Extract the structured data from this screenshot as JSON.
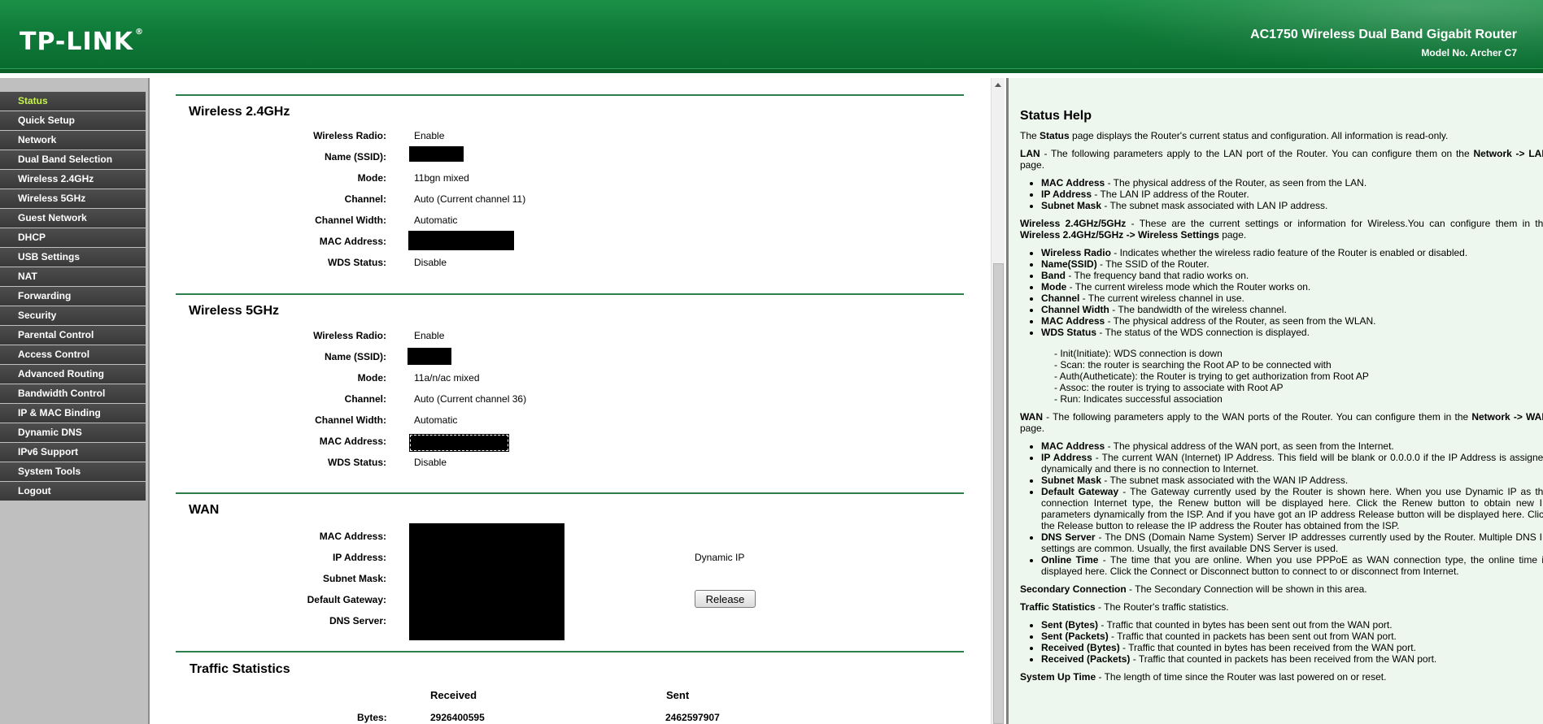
{
  "header": {
    "logo": "TP-LINK",
    "logo_mark": "®",
    "router_title": "AC1750 Wireless Dual Band Gigabit Router",
    "model_no": "Model No. Archer C7"
  },
  "nav": {
    "items": [
      {
        "label": "Status",
        "active": true
      },
      {
        "label": "Quick Setup"
      },
      {
        "label": "Network"
      },
      {
        "label": "Dual Band Selection"
      },
      {
        "label": "Wireless 2.4GHz"
      },
      {
        "label": "Wireless 5GHz"
      },
      {
        "label": "Guest Network"
      },
      {
        "label": "DHCP"
      },
      {
        "label": "USB Settings"
      },
      {
        "label": "NAT"
      },
      {
        "label": "Forwarding"
      },
      {
        "label": "Security"
      },
      {
        "label": "Parental Control"
      },
      {
        "label": "Access Control"
      },
      {
        "label": "Advanced Routing"
      },
      {
        "label": "Bandwidth Control"
      },
      {
        "label": "IP & MAC Binding"
      },
      {
        "label": "Dynamic DNS"
      },
      {
        "label": "IPv6 Support"
      },
      {
        "label": "System Tools"
      },
      {
        "label": "Logout"
      }
    ]
  },
  "w24": {
    "title": "Wireless 2.4GHz",
    "labels": [
      "Wireless Radio:",
      "Name (SSID):",
      "Mode:",
      "Channel:",
      "Channel Width:",
      "MAC Address:",
      "WDS Status:"
    ],
    "radio": "Enable",
    "mode": "11bgn mixed",
    "channel": "Auto (Current channel 11)",
    "width": "Automatic",
    "wds": "Disable"
  },
  "w5": {
    "title": "Wireless 5GHz",
    "labels": [
      "Wireless Radio:",
      "Name (SSID):",
      "Mode:",
      "Channel:",
      "Channel Width:",
      "MAC Address:",
      "WDS Status:"
    ],
    "radio": "Enable",
    "mode": "11a/n/ac mixed",
    "channel": "Auto (Current channel 36)",
    "width": "Automatic",
    "wds": "Disable"
  },
  "wan": {
    "title": "WAN",
    "labels": [
      "MAC Address:",
      "IP Address:",
      "Subnet Mask:",
      "Default Gateway:",
      "DNS Server:"
    ],
    "connection_type": "Dynamic IP",
    "release_label": "Release"
  },
  "traffic": {
    "title": "Traffic Statistics",
    "received_header": "Received",
    "sent_header": "Sent",
    "bytes_label": "Bytes:",
    "bytes_received": "2926400595",
    "bytes_sent": "2462597907"
  },
  "help": {
    "title": "Status Help",
    "intro_pre": "The ",
    "intro_b": "Status",
    "intro_post": " page displays the Router's current status and configuration. All information is read-only.",
    "lan_b": "LAN",
    "lan_text": " - The following parameters apply to the LAN port of the Router. You can configure them on the ",
    "lan_link": "Network -> LAN",
    "lan_end": " page.",
    "lan_items": [
      {
        "b": "MAC Address",
        "t": " - The physical address of the Router, as seen from the LAN."
      },
      {
        "b": "IP Address",
        "t": " - The LAN IP address of the Router."
      },
      {
        "b": "Subnet Mask",
        "t": " - The subnet mask associated with LAN IP address."
      }
    ],
    "wl_b": "Wireless 2.4GHz/5GHz",
    "wl_text": " - These are the current settings or information for Wireless.You can configure them in the ",
    "wl_link": "Wireless 2.4GHz/5GHz -> Wireless Settings",
    "wl_end": " page.",
    "wl_items": [
      {
        "b": "Wireless Radio",
        "t": " - Indicates whether the wireless radio feature of the Router is enabled or disabled."
      },
      {
        "b": "Name(SSID)",
        "t": " - The SSID of the Router."
      },
      {
        "b": "Band",
        "t": " - The frequency band that radio works on."
      },
      {
        "b": "Mode",
        "t": " - The current wireless mode which the Router works on."
      },
      {
        "b": "Channel",
        "t": " - The current wireless channel in use."
      },
      {
        "b": "Channel Width",
        "t": " - The bandwidth of the wireless channel."
      },
      {
        "b": "MAC Address",
        "t": " - The physical address of the Router, as seen from the WLAN."
      },
      {
        "b": "WDS Status",
        "t": " - The status of the WDS connection is displayed."
      }
    ],
    "wds_states": [
      "- Init(Initiate): WDS connection is down",
      "- Scan: the router is searching the Root AP to be connected with",
      "- Auth(Autheticate): the Router is trying to get authorization from Root AP",
      "- Assoc: the router is trying to associate with Root AP",
      "- Run: Indicates successful association"
    ],
    "wan_b": "WAN",
    "wan_text": " - The following parameters apply to the WAN ports of the Router. You can configure them in the ",
    "wan_link": "Network -> WAN",
    "wan_end": " page.",
    "wan_items": [
      {
        "b": "MAC Address",
        "t": " - The physical address of the WAN port, as seen from the Internet."
      },
      {
        "b": "IP Address",
        "t": " - The current WAN (Internet) IP Address. This field will be blank or 0.0.0.0 if the IP Address is assigned dynamically and there is no connection to Internet."
      },
      {
        "b": "Subnet Mask",
        "t": " - The subnet mask associated with the WAN IP Address."
      },
      {
        "b": "Default Gateway",
        "t": " - The Gateway currently used by the Router is shown here. When you use Dynamic IP as the connection Internet type, the Renew button will be displayed here. Click the Renew button to obtain new IP parameters dynamically from the ISP. And if you have got an IP address Release button will be displayed here. Click the Release button to release the IP address the Router has obtained from the ISP."
      },
      {
        "b": "DNS Server",
        "t": " - The DNS (Domain Name System) Server IP addresses currently used by the Router. Multiple DNS IP settings are common. Usually, the first available DNS Server is used."
      },
      {
        "b": "Online Time",
        "t": " - The time that you are online. When you use PPPoE as WAN connection type, the online time is displayed here. Click the Connect or Disconnect button to connect to or disconnect from Internet."
      }
    ],
    "sec_b": "Secondary Connection",
    "sec_text": " - The Secondary Connection will be shown in this area.",
    "ts_b": "Traffic Statistics",
    "ts_text": " - The Router's traffic statistics.",
    "ts_items": [
      {
        "b": "Sent (Bytes)",
        "t": " - Traffic that counted in bytes has been sent out from the WAN port."
      },
      {
        "b": "Sent (Packets)",
        "t": " - Traffic that counted in packets has been sent out from WAN port."
      },
      {
        "b": "Received (Bytes)",
        "t": " - Traffic that counted in bytes has been received from the WAN port."
      },
      {
        "b": "Received (Packets)",
        "t": " - Traffic that counted in packets has been received from the WAN port."
      }
    ],
    "up_b": "System Up Time",
    "up_text": " - The length of time since the Router was last powered on or reset."
  },
  "colors": {
    "header_green": "#0f7a38",
    "nav_active_text": "#c6f34a",
    "section_line": "#2e7d4a",
    "help_bg": "#eef7ee"
  }
}
